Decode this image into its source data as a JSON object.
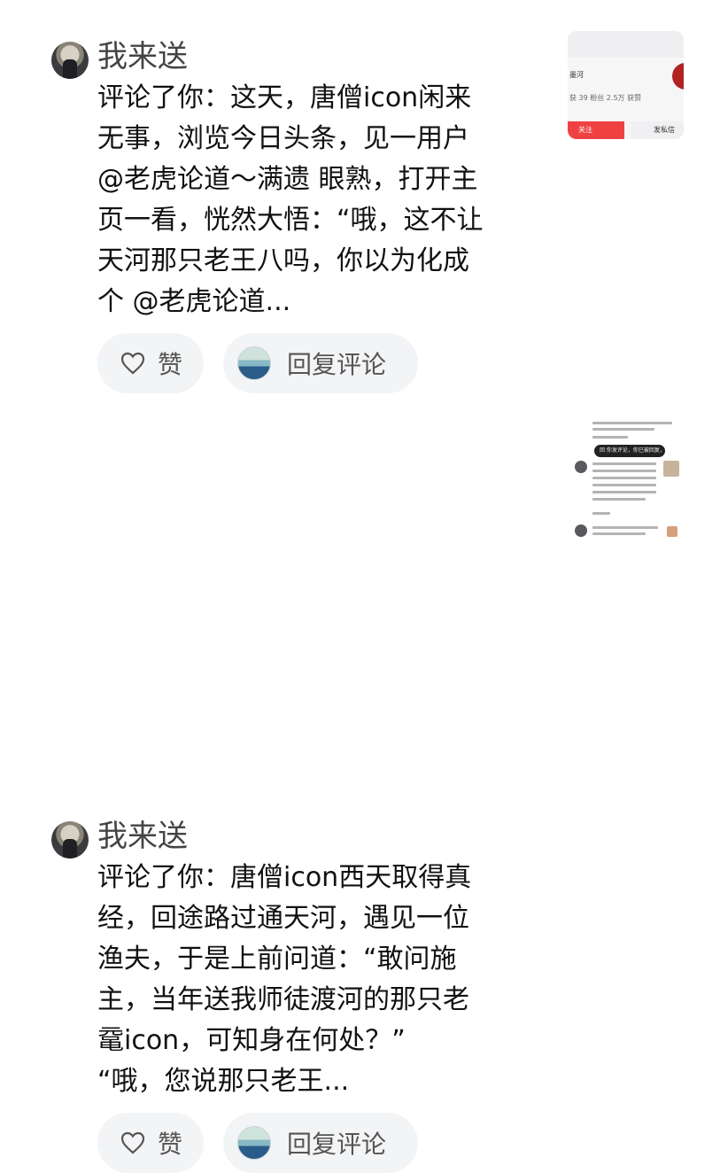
{
  "comments": [
    {
      "username": "我来送",
      "lines": [
        "评论了你：这天，唐僧icon闲来",
        "无事，浏览今日头条，见一用户",
        "@老虎论道～满遗  眼熟，打开主",
        "页一看，恍然大悟：“哦，这不让",
        "天河那只老王八吗，你以为化成",
        "个 @老虎论道..."
      ],
      "like_label": "赞",
      "reply_label": "回复评论"
    },
    {
      "username": "我来送",
      "lines": [
        "评论了你：唐僧icon西天取得真",
        "经，回途路过通天河，遇见一位",
        "渔夫，于是上前问道：“敢问施",
        "主，当年送我师徒渡河的那只老",
        "鼋icon，可知身在何处？”",
        "“哦，您说那只老王..."
      ],
      "like_label": "赞",
      "reply_label": "回复评论"
    }
  ],
  "preview1": {
    "name": "墨河",
    "stats": "获  39 粉丝  2.5万 获赞",
    "follow_label": "关注",
    "message_label": "发私信"
  },
  "preview2": {
    "bar_text": "回 你发评论，你已被回复，"
  },
  "colors": {
    "accent_red": "#f04142",
    "pill_bg": "#f3f4f6",
    "username": "#444444"
  }
}
